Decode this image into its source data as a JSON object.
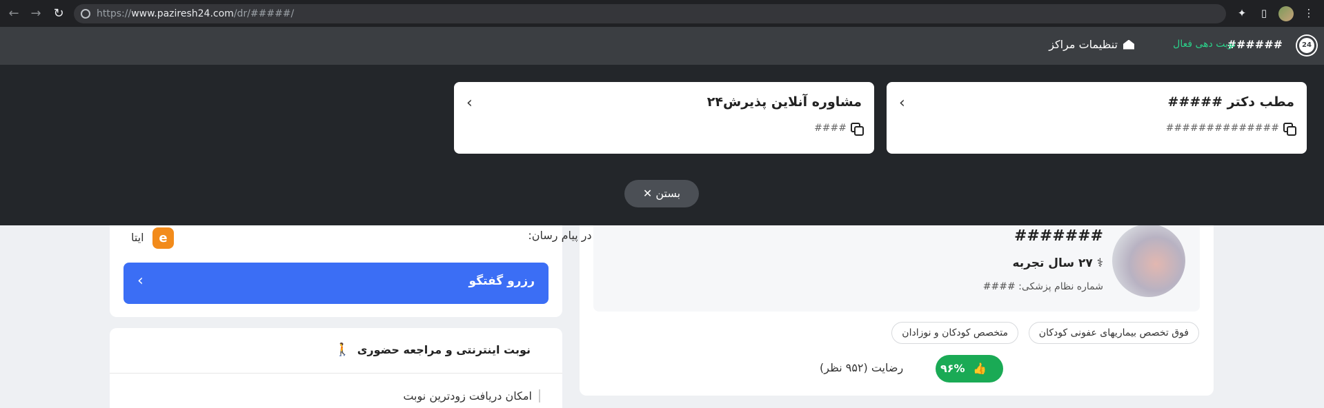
{
  "browser": {
    "url_prefix": "https://",
    "url_host": "www.paziresh24.com",
    "url_path": "/dr/#####/"
  },
  "header": {
    "logo_text": "24",
    "doctor": "######",
    "booking_status": "نوبت دهی فعال",
    "settings_label": "تنظیمات مراکز"
  },
  "overlay": {
    "cards": [
      {
        "title": "مطب دکتر #####",
        "subtitle": "##############"
      },
      {
        "title": "مشاوره آنلاین پذیرش۲۴",
        "subtitle": "####"
      }
    ],
    "close_label": "بستن"
  },
  "online_visit": {
    "label": "ویزیت آنلاین در پیام رسان:",
    "messenger": "ایتا",
    "chat_button": "رزرو گفتگو"
  },
  "in_person": {
    "title": "نوبت اینترنتی و مراجعه حضوری",
    "earliest": "امکان دریافت زودترین نوبت"
  },
  "doctor_profile": {
    "name": "#######",
    "experience": "۲۷ سال تجربه",
    "medical_number": "شماره نظام پزشکی: ####",
    "tags": [
      "فوق تخصص بیماریهای عفونی کودکان",
      "متخصص کودکان و نوزادان"
    ],
    "rating_percent": "۹۶%",
    "rating_text": "رضایت (۹۵۲ نظر)"
  },
  "colors": {
    "primary_button": "#3b6ef5",
    "rating_green": "#1aaa55",
    "active_green": "#2bd18a",
    "eitaa_orange": "#f28b1b"
  }
}
